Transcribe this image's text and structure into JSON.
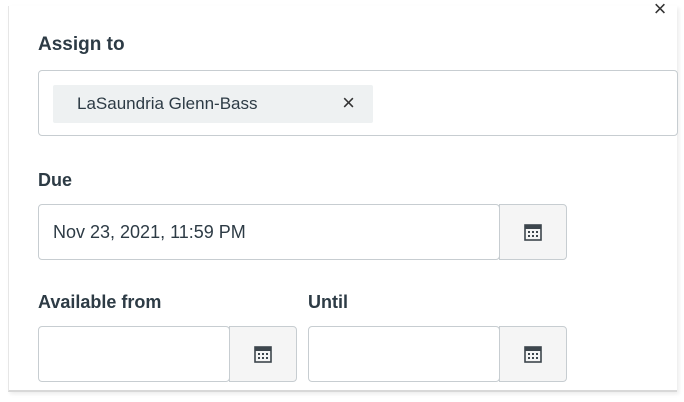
{
  "dialog": {
    "close_glyph": "×"
  },
  "assign": {
    "label": "Assign to",
    "token_name": "LaSaundria Glenn-Bass",
    "token_remove_glyph": "×"
  },
  "due": {
    "label": "Due",
    "value": "Nov 23, 2021, 11:59 PM",
    "calendar_icon": "calendar-icon"
  },
  "available_from": {
    "label": "Available from",
    "value": "",
    "calendar_icon": "calendar-icon"
  },
  "until": {
    "label": "Until",
    "value": "",
    "calendar_icon": "calendar-icon"
  },
  "colors": {
    "text": "#2d3b45",
    "border": "#c7cdd1",
    "token_bg": "#eef1f2",
    "button_bg": "#f5f5f5"
  }
}
